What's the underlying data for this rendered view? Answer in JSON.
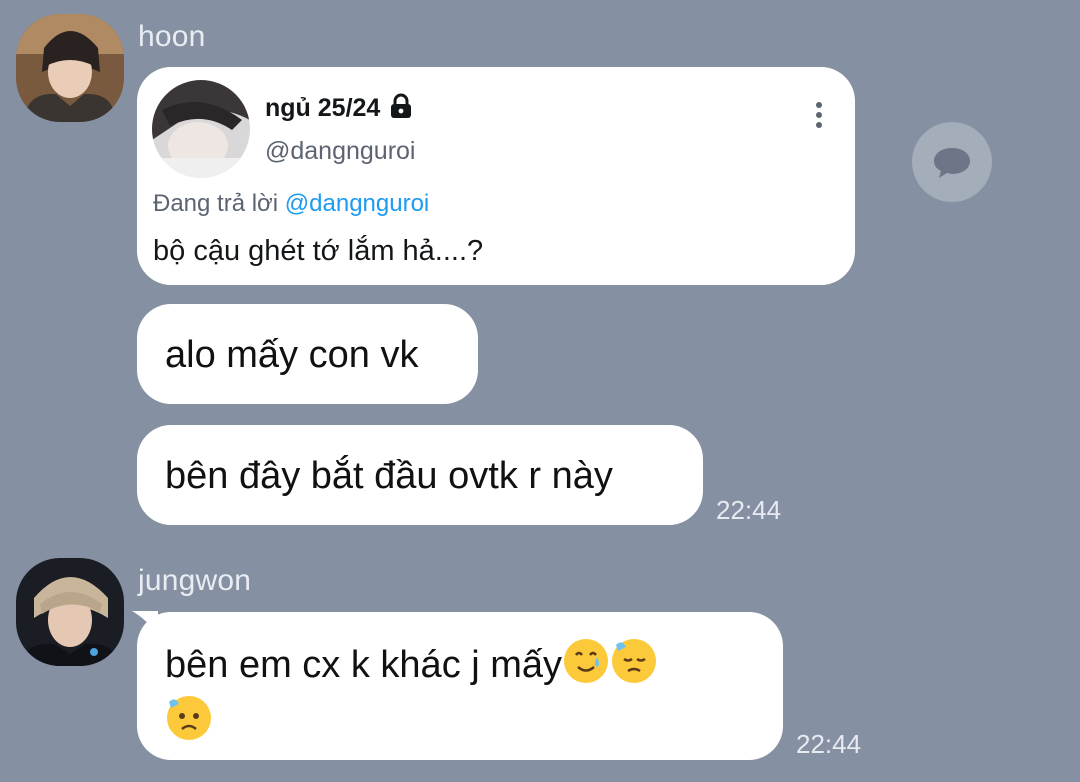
{
  "messages": [
    {
      "sender": "hoon",
      "tweet": {
        "display_name": "ngủ 25/24",
        "handle": "@dangnguroi",
        "reply_prefix": "Đang trả lời",
        "reply_to": "@dangnguroi",
        "text": "bộ cậu ghét tớ lắm hả....?"
      },
      "bubbles": [
        "alo mấy con vk",
        "bên đây bắt đầu ovtk r này"
      ],
      "time": "22:44"
    },
    {
      "sender": "jungwon",
      "bubble_text": "bên em cx k khác j mấy",
      "emojis": [
        "smiling-face-with-tear",
        "downcast-face-with-sweat",
        "sad-relieved-face"
      ],
      "time": "22:44"
    }
  ],
  "icons": {
    "lock": "lock-icon",
    "more": "more-options-icon",
    "share": "chat-bubble-icon"
  },
  "colors": {
    "background": "#8590a3",
    "bubble": "#ffffff",
    "link": "#1d9bf0"
  }
}
